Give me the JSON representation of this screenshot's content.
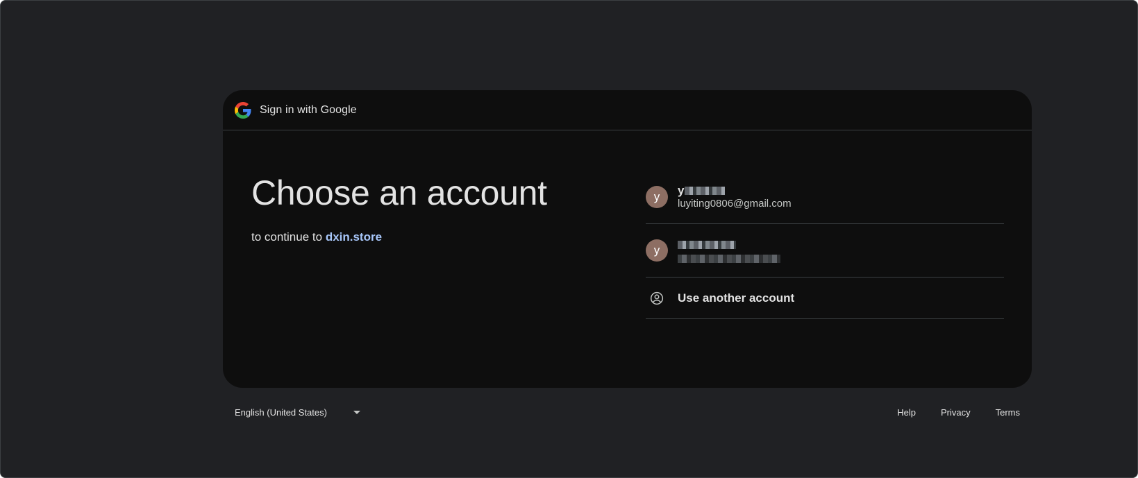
{
  "header": {
    "title": "Sign in with Google"
  },
  "main": {
    "headline": "Choose an account",
    "subtitle_prefix": "to continue to",
    "site": "dxin.store"
  },
  "accounts": [
    {
      "avatar_letter": "y",
      "avatar_color": "#8d6e63",
      "name": "y",
      "name_redacted": true,
      "email": "luyiting0806@gmail.com"
    },
    {
      "avatar_letter": "y",
      "avatar_color": "#8d6e63",
      "name": "",
      "name_redacted": true,
      "email": "",
      "email_redacted": true
    }
  ],
  "use_another": {
    "label": "Use another account",
    "icon": "account-circle-icon"
  },
  "footer": {
    "language": "English (United States)",
    "links": [
      "Help",
      "Privacy",
      "Terms"
    ]
  },
  "colors": {
    "background": "#202124",
    "card": "#0e0e0e",
    "link": "#a8c7fa",
    "text": "#e3e3e3",
    "divider": "#3c4043"
  }
}
